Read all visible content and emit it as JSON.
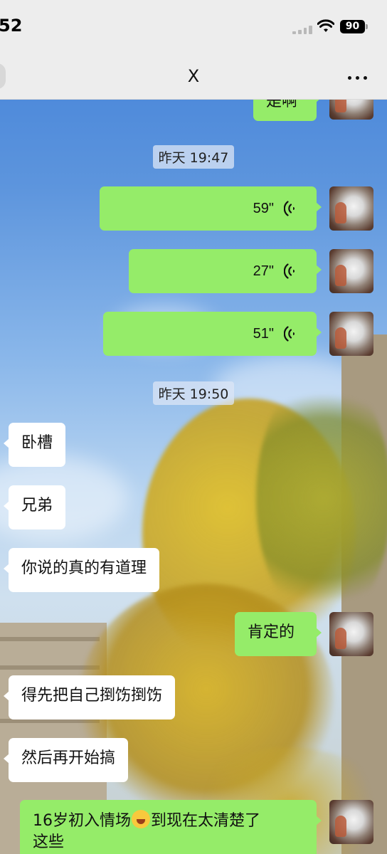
{
  "status_bar": {
    "time": "52",
    "battery_level": "90"
  },
  "nav": {
    "title": "X"
  },
  "messages": {
    "m0_partial": "是啊",
    "ts1": "昨天 19:47",
    "voice1": "59\"",
    "voice2": "27\"",
    "voice3": "51\"",
    "ts2": "昨天 19:50",
    "left1": "卧槽",
    "left2": "兄弟",
    "left3": "你说的真的有道理",
    "right4": "肯定的",
    "left5": "得先把自己捯饬捯饬",
    "left6": "然后再开始搞",
    "right7_part1": "16岁初入情场",
    "right7_emoji": "loudly-crying-face-icon",
    "right7_part2": "到现在太清楚了",
    "right7_line2": "这些"
  },
  "colors": {
    "nav_bg": "#ededed",
    "bubble_self": "#95ec69",
    "bubble_other": "#ffffff"
  }
}
